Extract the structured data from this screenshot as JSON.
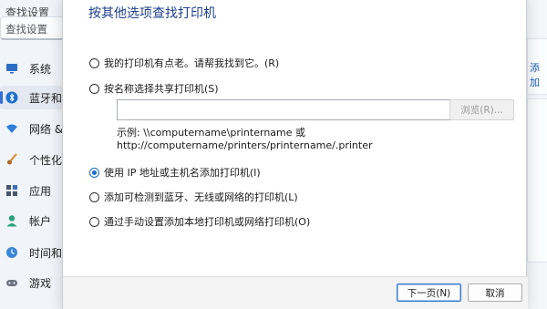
{
  "settings": {
    "title": "查找设置",
    "nav": [
      {
        "label": "系统",
        "icon": "monitor-icon"
      },
      {
        "label": "蓝牙和",
        "icon": "bluetooth-icon"
      },
      {
        "label": "网络 &",
        "icon": "wifi-icon"
      },
      {
        "label": "个性化",
        "icon": "brush-icon"
      },
      {
        "label": "应用",
        "icon": "apps-icon"
      },
      {
        "label": "帐户",
        "icon": "person-icon"
      },
      {
        "label": "时间和",
        "icon": "globe-clock-icon"
      },
      {
        "label": "游戏",
        "icon": "gamepad-icon"
      }
    ],
    "right_add": "添加",
    "colors": {
      "accent": "#2f6fd6"
    }
  },
  "dialog": {
    "heading": "按其他选项查找打印机",
    "options": {
      "older_printer": "我的打印机有点老。请帮我找到它。(R)",
      "by_name": "按名称选择共享打印机(S)",
      "by_ip": "使用 IP 地址或主机名添加打印机(I)",
      "wireless": "添加可检测到蓝牙、无线或网络的打印机(L)",
      "manual": "通过手动设置添加本地打印机或网络打印机(O)"
    },
    "selected_option": "by_ip",
    "share_input_value": "",
    "browse_label": "浏览(R)...",
    "example_line1": "示例: \\\\computername\\printername 或",
    "example_line2": "http://computername/printers/printername/.printer",
    "next_label": "下一页(N)",
    "cancel_label": "取消",
    "colors": {
      "heading": "#1d3f8c",
      "radio_selected": "#1a6bc9"
    }
  }
}
